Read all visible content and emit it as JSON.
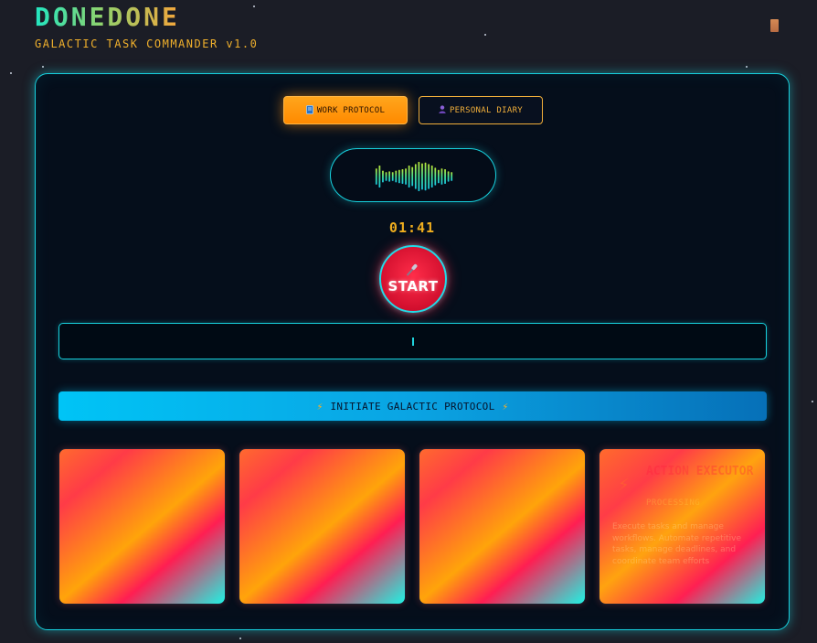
{
  "app": {
    "title": "DONEDONE",
    "subtitle": "GALACTIC TASK COMMANDER v1.0"
  },
  "modes": [
    {
      "label": "WORK PROTOCOL",
      "icon": "notebook-icon",
      "active": true
    },
    {
      "label": "PERSONAL DIARY",
      "icon": "person-icon",
      "active": false
    }
  ],
  "recorder": {
    "timer": "01:41",
    "start_label": "START",
    "start_icon": "microphone-icon",
    "waveform_levels": [
      0.55,
      0.75,
      0.4,
      0.3,
      0.35,
      0.3,
      0.4,
      0.45,
      0.5,
      0.55,
      0.75,
      0.65,
      0.85,
      1.0,
      0.9,
      0.95,
      0.85,
      0.75,
      0.6,
      0.45,
      0.55,
      0.5,
      0.35,
      0.3
    ]
  },
  "transcript": {
    "value": ""
  },
  "protocol_button": {
    "label": "INITIATE GALACTIC PROTOCOL",
    "icon": "lightning-icon"
  },
  "cards": [
    {
      "title": "",
      "subtitle": "",
      "description": ""
    },
    {
      "title": "",
      "subtitle": "",
      "description": ""
    },
    {
      "title": "",
      "subtitle": "",
      "description": ""
    },
    {
      "title": "ACTION EXECUTOR",
      "subtitle": "PROCESSING",
      "description": "Execute tasks and manage workflows. Automate repetitive tasks, manage deadlines, and coordinate team efforts",
      "icon": "lightning-icon"
    }
  ],
  "colors": {
    "accent_cyan": "#17d1de",
    "accent_orange": "#ff9a10",
    "record_red": "#e3132f",
    "background": "#1b1d26"
  }
}
